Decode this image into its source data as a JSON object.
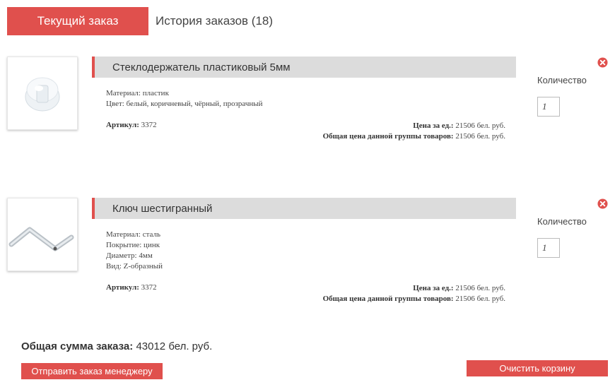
{
  "tabs": {
    "current": "Текущий заказ",
    "history": "История заказов (18)"
  },
  "products": [
    {
      "title": "Стеклодержатель пластиковый 5мм",
      "specs": [
        "Материал: пластик",
        "Цвет: белый, коричневый, чёрный, прозрачный"
      ],
      "article_label": "Артикул:",
      "article": "3372",
      "unit_price_label": "Цена за ед.:",
      "unit_price": "21506 бел. руб.",
      "group_price_label": "Общая цена данной группы товаров:",
      "group_price": "21506 бел. руб.",
      "qty_label": "Количество",
      "qty": "1",
      "image_icon": "plastic-glass-holder-icon"
    },
    {
      "title": "Ключ шестигранный",
      "specs": [
        "Материал: сталь",
        "Покрытие: цинк",
        "Диаметр: 4мм",
        "Вид: Z-образный"
      ],
      "article_label": "Артикул:",
      "article": "3372",
      "unit_price_label": "Цена за ед.:",
      "unit_price": "21506 бел. руб.",
      "group_price_label": "Общая цена данной группы товаров:",
      "group_price": "21506 бел. руб.",
      "qty_label": "Количество",
      "qty": "1",
      "image_icon": "hex-key-icon"
    }
  ],
  "summary": {
    "total_label": "Общая сумма заказа:",
    "total_value": "43012 бел. руб."
  },
  "actions": {
    "send_label": "Отправить заказ менеджеру",
    "clear_label": "Очистить корзину"
  },
  "colors": {
    "accent": "#e0504d",
    "title_bar": "#dcdcdc"
  }
}
